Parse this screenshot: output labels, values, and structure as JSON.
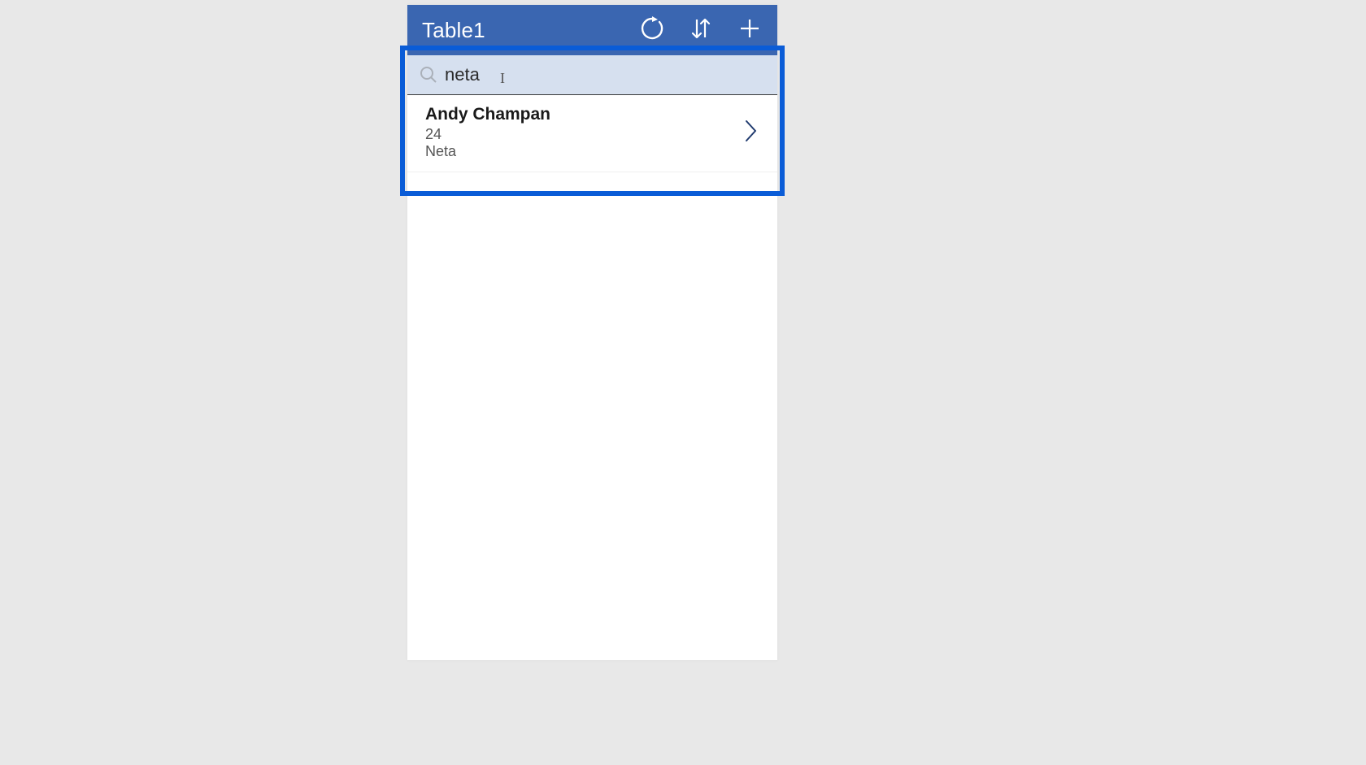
{
  "header": {
    "title": "Table1"
  },
  "search": {
    "value": "neta"
  },
  "results": [
    {
      "title": "Andy Champan",
      "subtitle1": "24",
      "subtitle2": "Neta"
    }
  ]
}
